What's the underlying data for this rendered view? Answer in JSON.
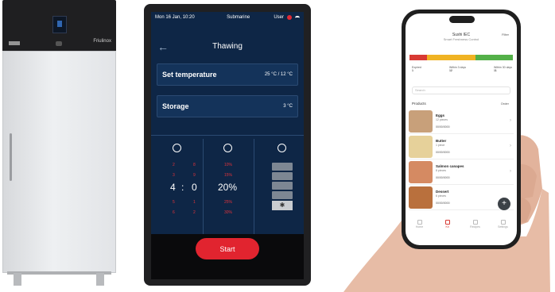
{
  "fridge": {
    "brand": "Friulinox"
  },
  "tablet": {
    "status": {
      "datetime": "Mon 16 Jan, 10:20",
      "name": "Submarine",
      "user": "User"
    },
    "title": "Thawing",
    "set_temperature": {
      "label": "Set temperature",
      "value": "25 °C / 12 °C"
    },
    "storage": {
      "label": "Storage",
      "value": "3 °C"
    },
    "timer": {
      "values_above": [
        "2",
        "3"
      ],
      "hours": "4",
      "separator": ":",
      "minutes": "0",
      "values_below": [
        "5",
        "6"
      ],
      "minute_above": [
        "8",
        "9"
      ],
      "minute_below": [
        "1",
        "2"
      ]
    },
    "humidity": {
      "above": [
        "10%",
        "15%"
      ],
      "value": "20%",
      "below": [
        "25%",
        "30%"
      ]
    },
    "start_label": "Start",
    "accent": "#e1242f",
    "bg": "#0e2646"
  },
  "phone": {
    "app_title": "Sushi IEC",
    "app_subtitle": "Smart Freshness Control",
    "filter_label": "Filter",
    "status_colors": [
      "#d83a34",
      "#f0b323",
      "#53b048"
    ],
    "stats": [
      {
        "label": "Expired",
        "value": "1"
      },
      {
        "label": "Within 3 days",
        "value": "12"
      },
      {
        "label": "Within 30 days",
        "value": "11"
      }
    ],
    "search_placeholder": "Search",
    "products_label": "Products",
    "products_filter": "Order",
    "products": [
      {
        "name": "Eggs",
        "meta": "12 pieces",
        "date": "00/00/0000",
        "color": "#c8a07a"
      },
      {
        "name": "Butter",
        "meta": "1 piece",
        "date": "00/00/0000",
        "color": "#e6d19a"
      },
      {
        "name": "Salmon canapes",
        "meta": "8 pieces",
        "date": "00/00/0000",
        "color": "#d58a62"
      },
      {
        "name": "Dessert",
        "meta": "6 pieces",
        "date": "00/00/0000",
        "color": "#b9703d"
      }
    ],
    "fab_label": "+",
    "tabs": [
      "Home",
      "Kit",
      "Recipes",
      "Settings"
    ],
    "active_tab": 1
  }
}
